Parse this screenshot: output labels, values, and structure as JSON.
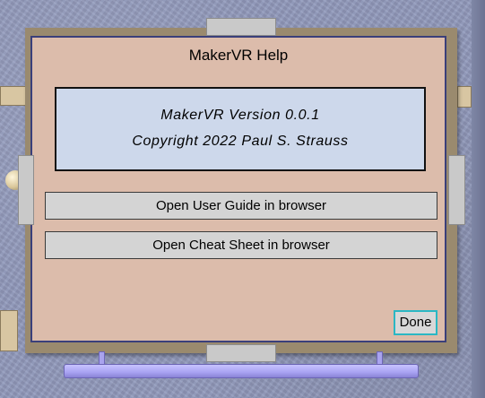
{
  "dialog": {
    "title": "MakerVR Help",
    "version_text": "MakerVR Version 0.0.1",
    "copyright_text": "Copyright 2022 Paul S. Strauss"
  },
  "buttons": {
    "user_guide": "Open User Guide in browser",
    "cheat_sheet": "Open Cheat Sheet in browser",
    "done": "Done"
  },
  "colors": {
    "panel_background": "#dcbcab",
    "info_box_background": "#cdd8eb",
    "button_background": "#d4d4d4",
    "done_focus_border": "#2ab7c4",
    "stand_bar": "#a8a2f2"
  }
}
